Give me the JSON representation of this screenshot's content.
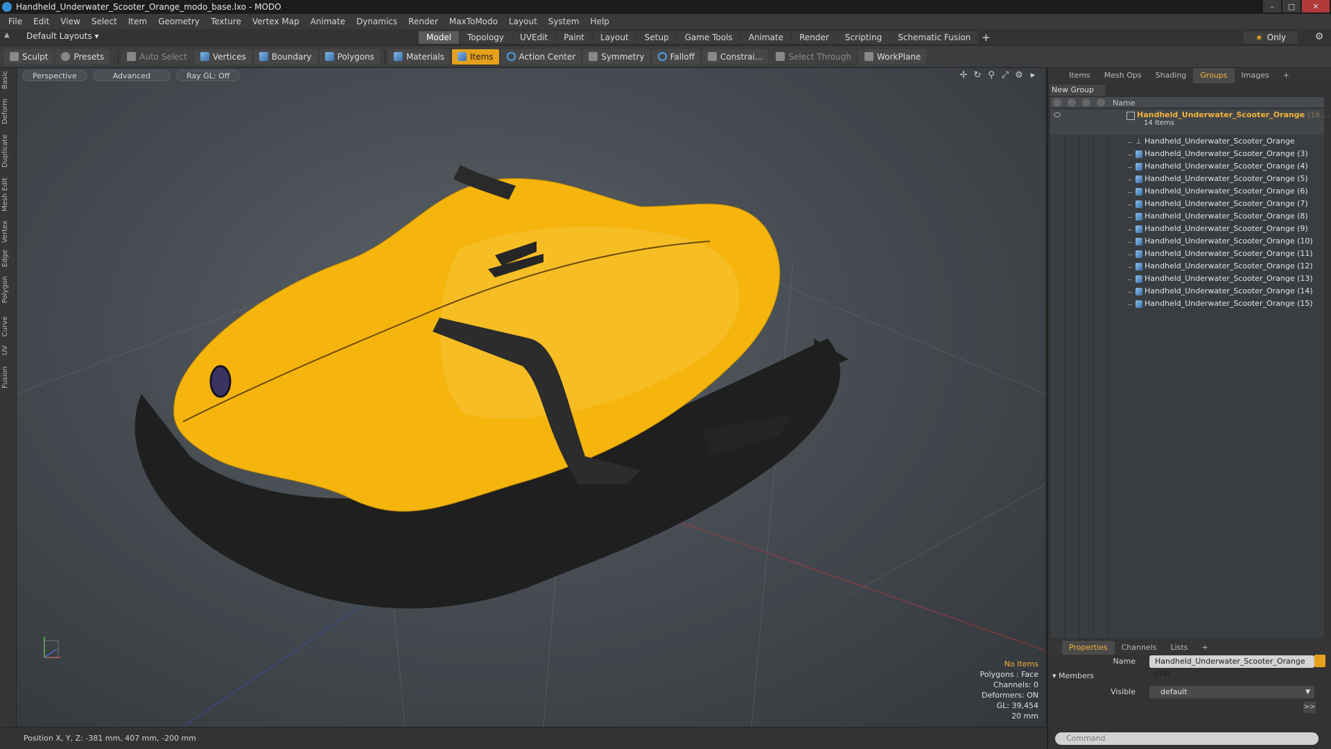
{
  "window": {
    "title": "Handheld_Underwater_Scooter_Orange_modo_base.lxo - MODO"
  },
  "menubar": [
    "File",
    "Edit",
    "View",
    "Select",
    "Item",
    "Geometry",
    "Texture",
    "Vertex Map",
    "Animate",
    "Dynamics",
    "Render",
    "MaxToModo",
    "Layout",
    "System",
    "Help"
  ],
  "layouts": {
    "label": "Default Layouts ▾"
  },
  "workspace_tabs": [
    {
      "label": "Model",
      "active": true
    },
    {
      "label": "Topology"
    },
    {
      "label": "UVEdit"
    },
    {
      "label": "Paint"
    },
    {
      "label": "Layout"
    },
    {
      "label": "Setup"
    },
    {
      "label": "Game Tools"
    },
    {
      "label": "Animate"
    },
    {
      "label": "Render"
    },
    {
      "label": "Scripting"
    },
    {
      "label": "Schematic Fusion"
    }
  ],
  "workspace_add": "+",
  "only_label": "Only",
  "toolbar": {
    "sculpt": "Sculpt",
    "presets": "Presets",
    "auto_select": "Auto Select",
    "vertices": "Vertices",
    "boundary": "Boundary",
    "polygons": "Polygons",
    "materials": "Materials",
    "items": "Items",
    "action_center": "Action Center",
    "symmetry": "Symmetry",
    "falloff": "Falloff",
    "constraints": "Constrai...",
    "select_through": "Select Through",
    "workplane": "WorkPlane"
  },
  "left_tabs": [
    "Basic",
    "Deform",
    "Duplicate",
    "Mesh Edit",
    "Vertex",
    "Edge",
    "Polygon",
    "Curve",
    "UV",
    "Fusion"
  ],
  "viewport": {
    "view": "Perspective",
    "shading": "Advanced",
    "raygl": "Ray GL: Off",
    "info": {
      "items": "No Items",
      "polygons": "Polygons : Face",
      "channels": "Channels: 0",
      "deformers": "Deformers: ON",
      "gl": "GL: 39,454",
      "scale": "20 mm"
    }
  },
  "status": {
    "position": "Position X, Y, Z:  -381 mm, 407 mm, -200 mm"
  },
  "panel_tabs": [
    {
      "label": "Items"
    },
    {
      "label": "Mesh Ops"
    },
    {
      "label": "Shading"
    },
    {
      "label": "Groups",
      "active": true
    },
    {
      "label": "Images"
    },
    {
      "label": "+"
    }
  ],
  "groups": {
    "new_group": "New Group",
    "column_name": "Name",
    "group_name": "Handheld_Underwater_Scooter_Orange",
    "group_count": "(16 ...",
    "group_items": "14 Items",
    "items": [
      "Handheld_Underwater_Scooter_Orange",
      "Handheld_Underwater_Scooter_Orange (3)",
      "Handheld_Underwater_Scooter_Orange (4)",
      "Handheld_Underwater_Scooter_Orange (5)",
      "Handheld_Underwater_Scooter_Orange (6)",
      "Handheld_Underwater_Scooter_Orange (7)",
      "Handheld_Underwater_Scooter_Orange (8)",
      "Handheld_Underwater_Scooter_Orange (9)",
      "Handheld_Underwater_Scooter_Orange (10)",
      "Handheld_Underwater_Scooter_Orange (11)",
      "Handheld_Underwater_Scooter_Orange (12)",
      "Handheld_Underwater_Scooter_Orange (13)",
      "Handheld_Underwater_Scooter_Orange (14)",
      "Handheld_Underwater_Scooter_Orange (15)"
    ]
  },
  "props_tabs": [
    {
      "label": "Properties",
      "active": true
    },
    {
      "label": "Channels"
    },
    {
      "label": "Lists"
    },
    {
      "label": "+"
    }
  ],
  "properties": {
    "name_label": "Name",
    "name_value": "Handheld_Underwater_Scooter_Orange (16)",
    "members": "Members",
    "visible_label": "Visible",
    "visible_value": "default",
    "expand": ">>"
  },
  "command": {
    "placeholder": "Command"
  },
  "colors": {
    "accent": "#e6a11c",
    "scooter_body": "#f5b50c",
    "scooter_base": "#1e1e1e"
  }
}
